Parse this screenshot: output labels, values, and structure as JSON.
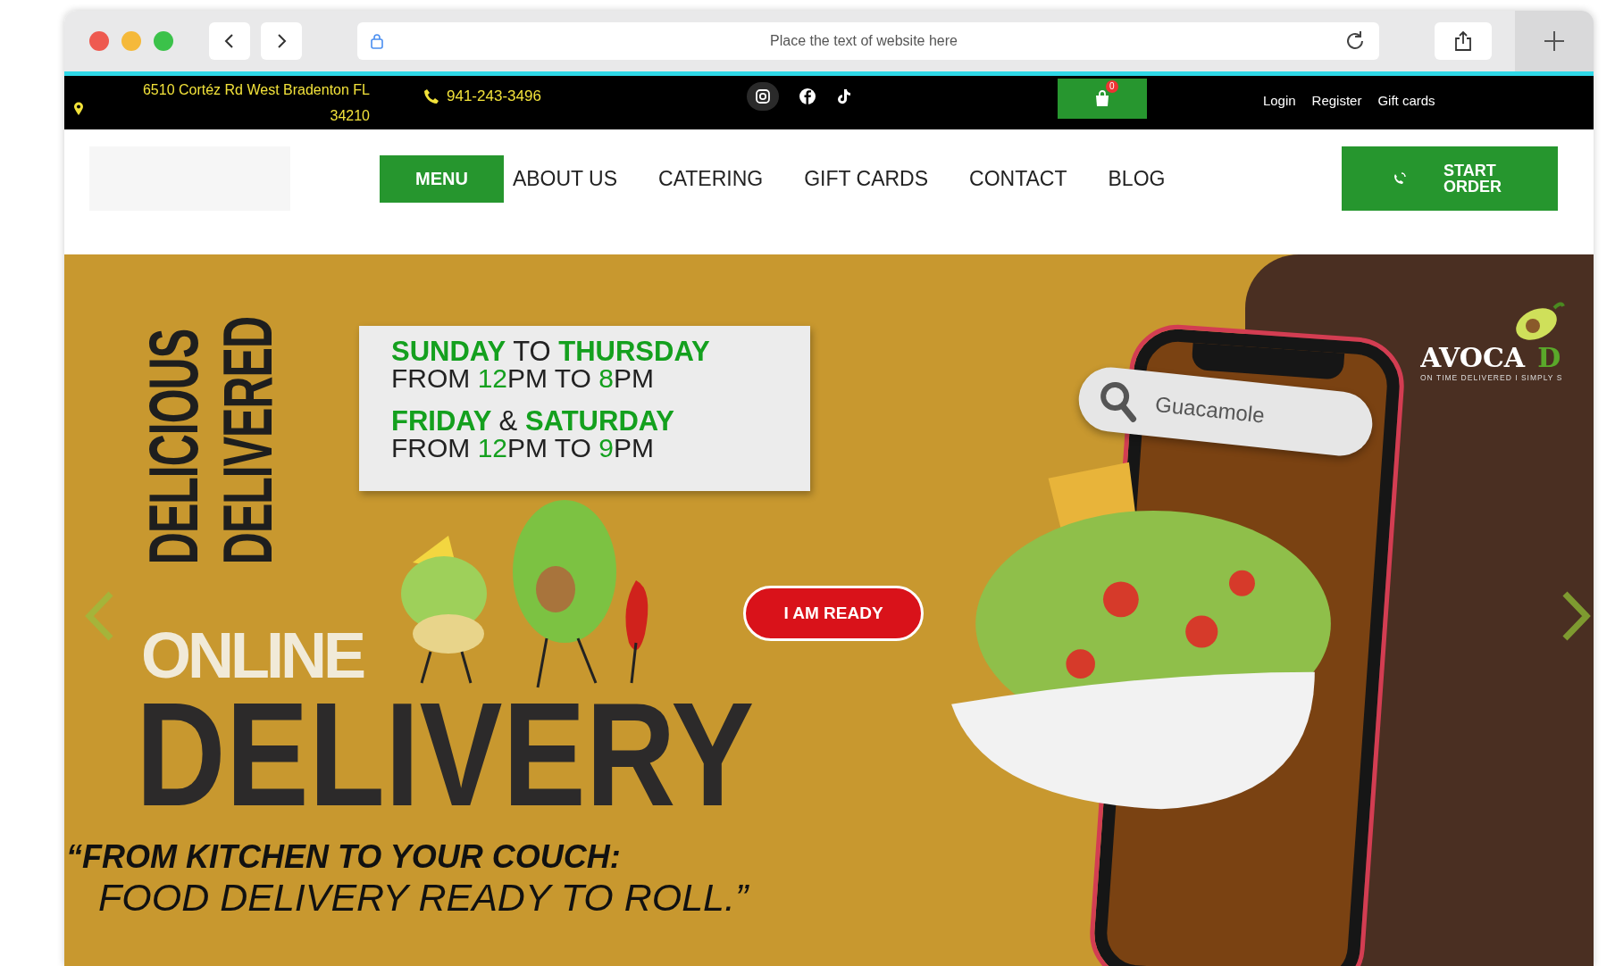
{
  "browser": {
    "address_placeholder": "Place the text of website here"
  },
  "top_bar": {
    "address": "6510 Cortéz Rd West Bradenton FL 34210",
    "phone": "941-243-3496",
    "cart_count": "0",
    "links": [
      "Login",
      "Register",
      "Gift cards"
    ]
  },
  "nav": {
    "items": [
      {
        "label": "MENU",
        "selected": true
      },
      {
        "label": "ABOUT US",
        "selected": false
      },
      {
        "label": "CATERING",
        "selected": false
      },
      {
        "label": "GIFT CARDS",
        "selected": false
      },
      {
        "label": "CONTACT",
        "selected": false
      },
      {
        "label": "BLOG",
        "selected": false
      }
    ],
    "start_order": "START ORDER"
  },
  "hero": {
    "vertical_lines": [
      "DELICIOUS",
      "DELIVERED"
    ],
    "online": "ONLINE",
    "delivery": "DELIVERY",
    "hours": [
      {
        "days": [
          {
            "text": "SUNDAY",
            "highlight": true
          },
          {
            "text": "TO",
            "highlight": false
          },
          {
            "text": "THURSDAY",
            "highlight": true
          }
        ],
        "times": [
          {
            "text": "FROM ",
            "highlight": false
          },
          {
            "text": "12",
            "highlight": true
          },
          {
            "text": "PM TO ",
            "highlight": false
          },
          {
            "text": "8",
            "highlight": true
          },
          {
            "text": "PM",
            "highlight": false
          }
        ]
      },
      {
        "days": [
          {
            "text": "FRIDAY",
            "highlight": true
          },
          {
            "text": "&",
            "highlight": false
          },
          {
            "text": "SATURDAY",
            "highlight": true
          }
        ],
        "times": [
          {
            "text": "FROM ",
            "highlight": false
          },
          {
            "text": "12",
            "highlight": true
          },
          {
            "text": "PM TO ",
            "highlight": false
          },
          {
            "text": "9",
            "highlight": true
          },
          {
            "text": "PM",
            "highlight": false
          }
        ]
      }
    ],
    "cta": "I AM READY",
    "search_text": "Guacamole",
    "brand": "AVOCA",
    "brand_cut": "D",
    "tagline": "ON TIME DELIVERED I SIMPLY S",
    "quote_line_1": "“FROM KITCHEN TO YOUR COUCH:",
    "quote_line_2": "FOOD DELIVERY READY TO ROLL.”"
  }
}
